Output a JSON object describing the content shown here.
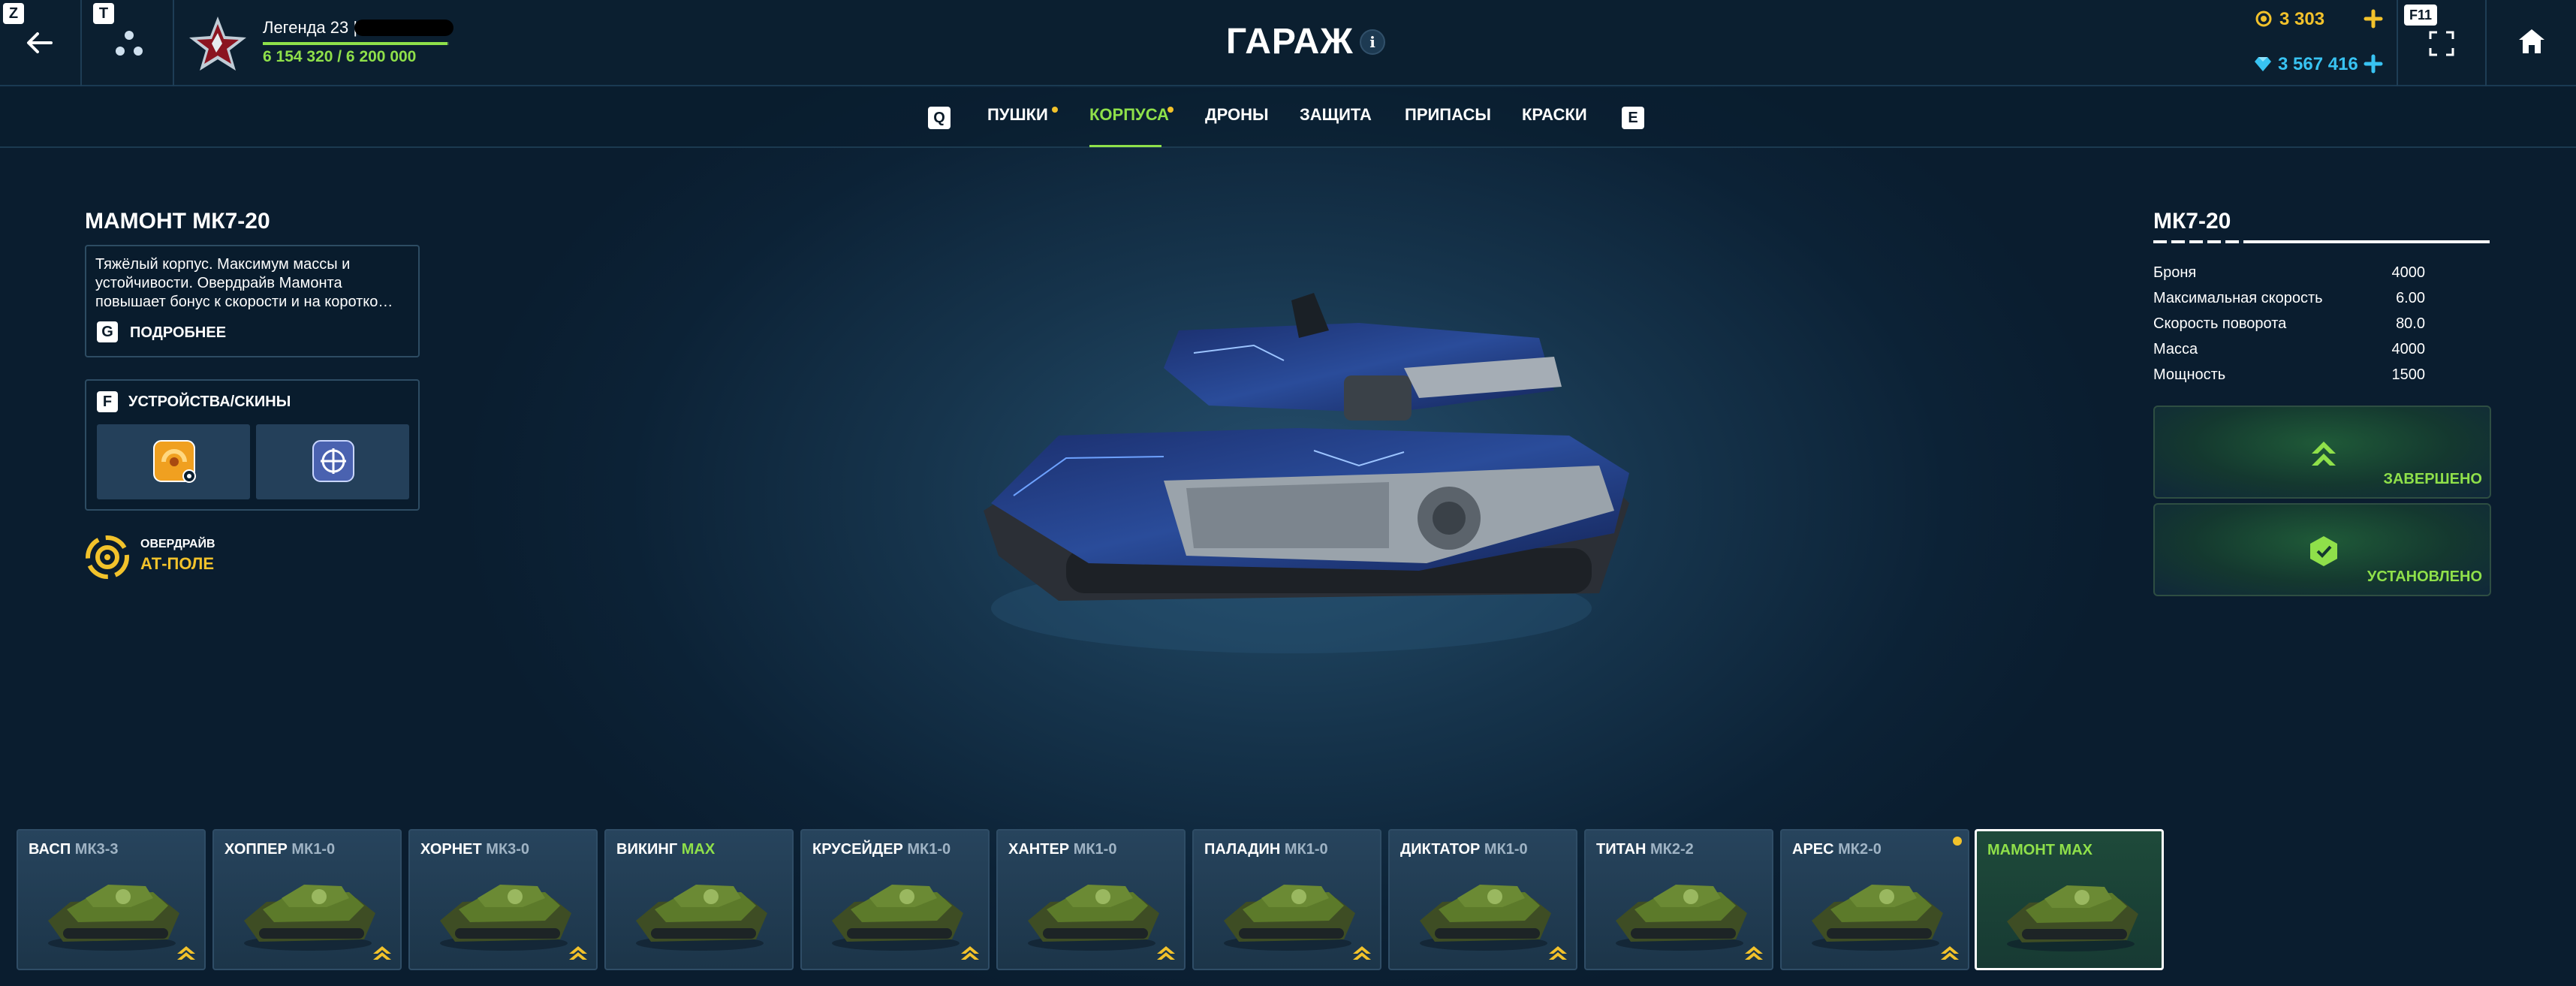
{
  "header": {
    "keys": {
      "back": "Z",
      "social": "T",
      "fullscreen": "F11"
    },
    "player": {
      "rank_name": "Легенда 23 |",
      "xp": "6 154 320 / 6 200 000",
      "xp_fraction": 0.9926
    },
    "title": "ГАРАЖ",
    "info_icon": "i",
    "currency": {
      "crystals": "3 303",
      "tankoins": "3 567 416"
    },
    "colors": {
      "accent_green": "#8fe04a",
      "gold": "#f2c22b",
      "cyan": "#38c3f2"
    }
  },
  "tabs": {
    "prev_key": "Q",
    "next_key": "E",
    "items": [
      {
        "label": "ПУШКИ",
        "notify": true
      },
      {
        "label": "КОРПУСА",
        "notify": true,
        "active": true
      },
      {
        "label": "ДРОНЫ"
      },
      {
        "label": "ЗАЩИТА"
      },
      {
        "label": "ПРИПАСЫ"
      },
      {
        "label": "КРАСКИ"
      }
    ]
  },
  "item": {
    "name": "МАМОНТ МК7-20",
    "description": "Тяжёлый корпус. Максимум массы и устойчивости. Овердрайв Мамонта повышает бонус к скорости и на коротко…",
    "more_key": "G",
    "more_label": "ПОДРОБНЕЕ",
    "devices_key": "F",
    "devices_label": "УСТРОЙСТВА/СКИНЫ",
    "overdrive_caption": "ОВЕРДРАЙВ",
    "overdrive_name": "АТ-ПОЛЕ"
  },
  "stats": {
    "mk": "МК7-20",
    "progress_fraction": 0.3,
    "rows": [
      {
        "label": "Броня",
        "value": "4000"
      },
      {
        "label": "Максимальная скорость",
        "value": "6.00"
      },
      {
        "label": "Скорость поворота",
        "value": "80.0"
      },
      {
        "label": "Масса",
        "value": "4000"
      },
      {
        "label": "Мощность",
        "value": "1500"
      }
    ],
    "upgrade_status": "ЗАВЕРШЕНО",
    "equip_status": "УСТАНОВЛЕНО"
  },
  "hulls": [
    {
      "name": "ВАСП",
      "mk": "МК3-3",
      "upgrade": true
    },
    {
      "name": "ХОППЕР",
      "mk": "МК1-0",
      "upgrade": true
    },
    {
      "name": "ХОРНЕТ",
      "mk": "МК3-0",
      "upgrade": true
    },
    {
      "name": "ВИКИНГ",
      "max": "MAX"
    },
    {
      "name": "КРУСЕЙДЕР",
      "mk": "МК1-0",
      "upgrade": true
    },
    {
      "name": "ХАНТЕР",
      "mk": "МК1-0",
      "upgrade": true
    },
    {
      "name": "ПАЛАДИН",
      "mk": "МК1-0",
      "upgrade": true
    },
    {
      "name": "ДИКТАТОР",
      "mk": "МК1-0",
      "upgrade": true
    },
    {
      "name": "ТИТАН",
      "mk": "МК2-2",
      "upgrade": true
    },
    {
      "name": "АРЕС",
      "mk": "МК2-0",
      "upgrade": true,
      "notify": true
    },
    {
      "name": "МАМОНТ",
      "max": "MAX",
      "selected": true
    }
  ]
}
